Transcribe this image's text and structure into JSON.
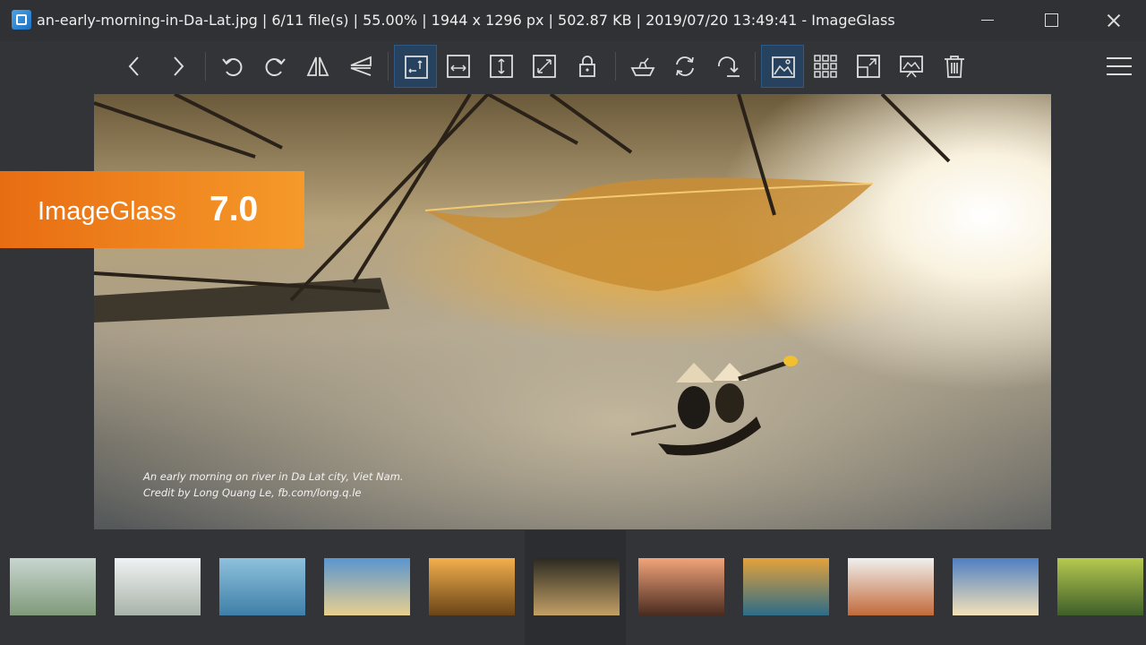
{
  "window": {
    "title": "an-early-morning-in-Da-Lat.jpg  |  6/11 file(s)  |  55.00%  |  1944 x 1296 px  |  502.87 KB  |  2019/07/20 13:49:41  - ImageGlass"
  },
  "toolbar": {
    "buttons": [
      {
        "name": "previous-image",
        "icon": "chevron-left-icon"
      },
      {
        "name": "next-image",
        "icon": "chevron-right-icon"
      },
      {
        "name": "rotate-left",
        "icon": "rotate-left-icon"
      },
      {
        "name": "rotate-right",
        "icon": "rotate-right-icon"
      },
      {
        "name": "flip-horizontal",
        "icon": "flip-horizontal-icon"
      },
      {
        "name": "flip-vertical",
        "icon": "flip-vertical-icon"
      },
      {
        "name": "auto-zoom",
        "icon": "auto-zoom-icon",
        "active": true
      },
      {
        "name": "scale-to-width",
        "icon": "scale-width-icon"
      },
      {
        "name": "scale-to-height",
        "icon": "scale-height-icon"
      },
      {
        "name": "scale-to-fit",
        "icon": "scale-fit-icon"
      },
      {
        "name": "lock-zoom",
        "icon": "lock-icon"
      },
      {
        "name": "open-with",
        "icon": "open-with-icon"
      },
      {
        "name": "refresh",
        "icon": "refresh-icon"
      },
      {
        "name": "go-to-image",
        "icon": "goto-icon"
      },
      {
        "name": "checkerboard-background",
        "icon": "image-icon",
        "active": true
      },
      {
        "name": "thumbnail-bar",
        "icon": "grid-icon"
      },
      {
        "name": "full-screen",
        "icon": "fullscreen-icon"
      },
      {
        "name": "slideshow",
        "icon": "slideshow-icon"
      },
      {
        "name": "delete",
        "icon": "trash-icon"
      }
    ],
    "menu_icon": "hamburger-menu-icon"
  },
  "viewer": {
    "caption_line1": "An early morning on river in Da Lat city, Viet Nam.",
    "caption_line2": "Credit by Long Quang Le, fb.com/long.q.le"
  },
  "badge": {
    "name": "ImageGlass",
    "version": "7.0"
  },
  "thumbnails": {
    "selected_index": 5,
    "items": [
      {
        "theme": "misty-valley",
        "colors": [
          "#c9d6d0",
          "#7f9a7a"
        ]
      },
      {
        "theme": "clouds-over-hills",
        "colors": [
          "#f0f2f3",
          "#a9b3a9"
        ]
      },
      {
        "theme": "fisherman-blue",
        "colors": [
          "#8ec1dc",
          "#3f7fa8"
        ]
      },
      {
        "theme": "fishing-net-sunrise",
        "colors": [
          "#5a95cf",
          "#e8cf8f"
        ]
      },
      {
        "theme": "golden-fog",
        "colors": [
          "#f3b04d",
          "#6a4418"
        ]
      },
      {
        "theme": "early-morning-river",
        "colors": [
          "#2c2a22",
          "#c3a065"
        ]
      },
      {
        "theme": "buffalo-sunset",
        "colors": [
          "#f1a47a",
          "#4a2b20"
        ]
      },
      {
        "theme": "river-boats",
        "colors": [
          "#e4a23a",
          "#2d6c88"
        ]
      },
      {
        "theme": "foggy-trees",
        "colors": [
          "#f0f0ee",
          "#c26a3a"
        ]
      },
      {
        "theme": "pier-sunrise",
        "colors": [
          "#4f7fc2",
          "#f4e2b8"
        ]
      },
      {
        "theme": "green-lake",
        "colors": [
          "#b6c94f",
          "#3f5f2a"
        ]
      }
    ]
  }
}
